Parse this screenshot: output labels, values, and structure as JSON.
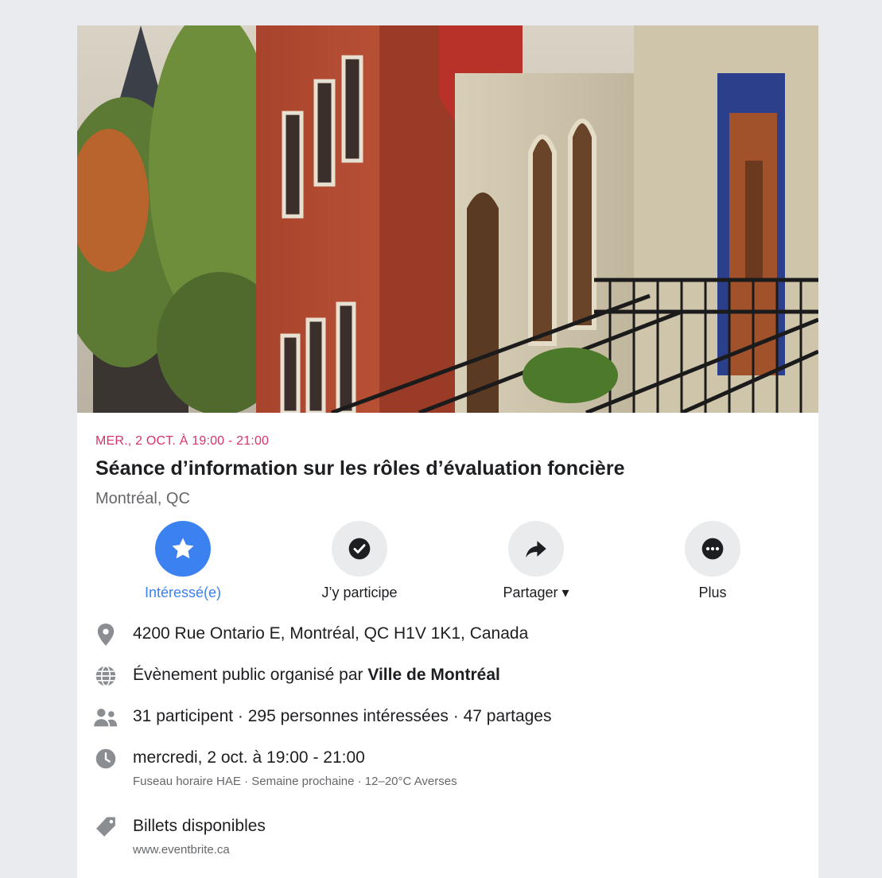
{
  "event": {
    "date_line": "MER., 2 OCT. À 19:00 - 21:00",
    "title": "Séance d’information sur les rôles d’évaluation foncière",
    "location": "Montréal, QC"
  },
  "actions": [
    {
      "label": "Intéressé(e)",
      "icon": "star-icon",
      "active": true
    },
    {
      "label": "J’y participe",
      "icon": "check-circle-icon",
      "active": false
    },
    {
      "label": "Partager ▾",
      "icon": "share-icon",
      "active": false
    },
    {
      "label": "Plus",
      "icon": "more-icon",
      "active": false
    }
  ],
  "details": {
    "address": "4200 Rue Ontario E, Montréal, QC H1V 1K1, Canada",
    "organizer_prefix": "Évènement public organisé par ",
    "organizer_name": "Ville de Montréal",
    "stats": "31 participent · 295 personnes intéressées · 47 partages",
    "datetime": "mercredi, 2 oct. à 19:00 - 21:00",
    "datetime_sub": "Fuseau horaire HAE · Semaine prochaine · 12–20°C Averses",
    "tickets": "Billets disponibles",
    "tickets_url": "www.eventbrite.ca"
  },
  "colors": {
    "accent": "#3b82f0",
    "date": "#d6336c",
    "secondary_text": "#65676b",
    "icon_gray": "#8a8d91"
  }
}
